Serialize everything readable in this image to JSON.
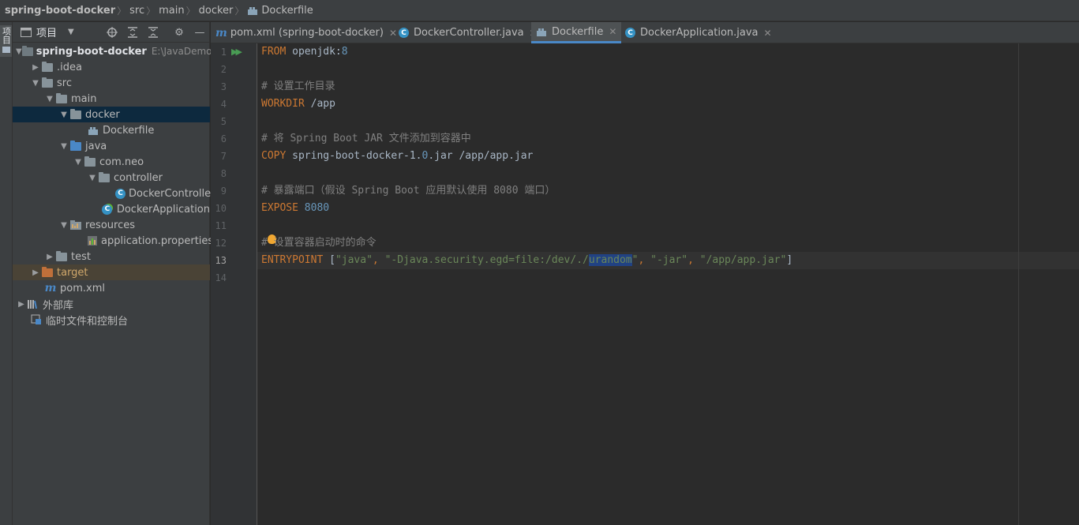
{
  "breadcrumb": [
    "spring-boot-docker",
    "src",
    "main",
    "docker",
    "Dockerfile"
  ],
  "left_strip": {
    "label": "项目"
  },
  "project_panel": {
    "title": "项目",
    "toolbar_icons": [
      "locate-icon",
      "expand-all-icon",
      "collapse-all-icon",
      "gear-icon",
      "minimize-icon"
    ]
  },
  "tree": [
    {
      "label": "spring-boot-docker",
      "hint": "E:\\JavaDemos",
      "icon": "folder-dark",
      "arrow": "open"
    },
    {
      "label": ".idea",
      "icon": "folder",
      "arrow": "closed"
    },
    {
      "label": "src",
      "icon": "folder",
      "arrow": "open"
    },
    {
      "label": "main",
      "icon": "folder",
      "arrow": "open"
    },
    {
      "label": "docker",
      "icon": "folder",
      "arrow": "open",
      "selected": true
    },
    {
      "label": "Dockerfile",
      "icon": "docker-file-icon"
    },
    {
      "label": "java",
      "icon": "folder-blue",
      "arrow": "open"
    },
    {
      "label": "com.neo",
      "icon": "package",
      "arrow": "open"
    },
    {
      "label": "controller",
      "icon": "package",
      "arrow": "open"
    },
    {
      "label": "DockerController",
      "icon": "class-icon"
    },
    {
      "label": "DockerApplication",
      "icon": "spring-class-icon"
    },
    {
      "label": "resources",
      "icon": "resources-folder",
      "arrow": "open"
    },
    {
      "label": "application.properties",
      "icon": "properties-file-icon"
    },
    {
      "label": "test",
      "icon": "folder",
      "arrow": "closed"
    },
    {
      "label": "target",
      "icon": "folder-orange",
      "arrow": "closed",
      "excluded": true
    },
    {
      "label": "pom.xml",
      "icon": "maven-icon"
    },
    {
      "label": "外部库",
      "icon": "library-icon",
      "arrow": "closed"
    },
    {
      "label": "临时文件和控制台",
      "icon": "scratch-icon"
    }
  ],
  "tabs": [
    {
      "label": "pom.xml (spring-boot-docker)",
      "icon": "maven-icon",
      "active": false
    },
    {
      "label": "DockerController.java",
      "icon": "class-icon",
      "active": false
    },
    {
      "label": "Dockerfile",
      "icon": "docker-file-icon",
      "active": true
    },
    {
      "label": "DockerApplication.java",
      "icon": "class-icon",
      "active": false
    }
  ],
  "editor": {
    "current_line": 13,
    "line_numbers": [
      "1",
      "2",
      "3",
      "4",
      "5",
      "6",
      "7",
      "8",
      "9",
      "10",
      "11",
      "12",
      "13",
      "14"
    ],
    "lines": [
      {
        "n": 1,
        "tokens": [
          {
            "t": "FROM",
            "c": "kw"
          },
          {
            "t": " openjdk:",
            "c": ""
          },
          {
            "t": "8",
            "c": "num"
          }
        ]
      },
      {
        "n": 2,
        "tokens": []
      },
      {
        "n": 3,
        "tokens": [
          {
            "t": "# 设置工作目录",
            "c": "cm"
          }
        ]
      },
      {
        "n": 4,
        "tokens": [
          {
            "t": "WORKDIR",
            "c": "kw"
          },
          {
            "t": " /app",
            "c": ""
          }
        ]
      },
      {
        "n": 5,
        "tokens": []
      },
      {
        "n": 6,
        "tokens": [
          {
            "t": "# 将 Spring Boot JAR 文件添加到容器中",
            "c": "cm"
          }
        ]
      },
      {
        "n": 7,
        "tokens": [
          {
            "t": "COPY",
            "c": "kw"
          },
          {
            "t": " spring-boot-docker-1.",
            "c": ""
          },
          {
            "t": "0",
            "c": "num"
          },
          {
            "t": ".jar /app/app.jar",
            "c": ""
          }
        ]
      },
      {
        "n": 8,
        "tokens": []
      },
      {
        "n": 9,
        "tokens": [
          {
            "t": "# 暴露端口（假设 Spring Boot 应用默认使用 8080 端口）",
            "c": "cm"
          }
        ]
      },
      {
        "n": 10,
        "tokens": [
          {
            "t": "EXPOSE",
            "c": "kw"
          },
          {
            "t": " ",
            "c": ""
          },
          {
            "t": "8080",
            "c": "num"
          }
        ]
      },
      {
        "n": 11,
        "tokens": []
      },
      {
        "n": 12,
        "tokens": [
          {
            "t": "# 设置容器启动时的命令",
            "c": "cm"
          }
        ]
      },
      {
        "n": 13,
        "tokens": [
          {
            "t": "ENTRYPOINT",
            "c": "kw"
          },
          {
            "t": " [",
            "c": ""
          },
          {
            "t": "\"java\"",
            "c": "str"
          },
          {
            "t": ", ",
            "c": "kw"
          },
          {
            "t": "\"-Djava.security.egd=file:/dev/./",
            "c": "str"
          },
          {
            "t": "urandom",
            "c": "hl"
          },
          {
            "t": "\"",
            "c": "str"
          },
          {
            "t": ", ",
            "c": "kw"
          },
          {
            "t": "\"-jar\"",
            "c": "str"
          },
          {
            "t": ", ",
            "c": "kw"
          },
          {
            "t": "\"/app/app.jar\"",
            "c": "str"
          },
          {
            "t": "]",
            "c": ""
          }
        ]
      },
      {
        "n": 14,
        "tokens": []
      }
    ]
  },
  "colors": {
    "keyword": "#cc7832",
    "string": "#6a8759",
    "number": "#6897bb",
    "comment": "#808080",
    "selection": "#214283",
    "tab_underline": "#4a88c7"
  }
}
